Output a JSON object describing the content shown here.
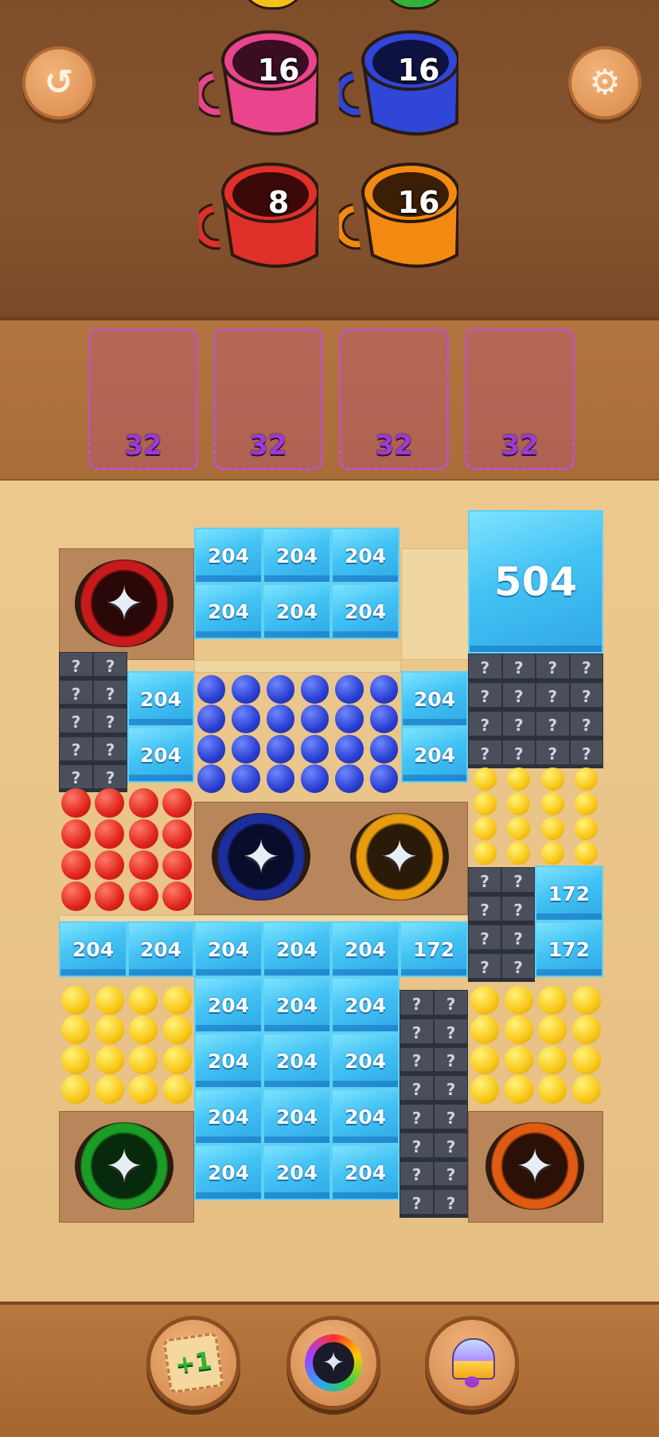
{
  "header": {
    "restart_button": {
      "icon": "restart-icon"
    },
    "settings_button": {
      "icon": "gear-icon"
    }
  },
  "cups": [
    {
      "color": "#e8458c",
      "count": "16"
    },
    {
      "color": "#2f46d6",
      "count": "16"
    },
    {
      "color": "#e0302a",
      "count": "8"
    },
    {
      "color": "#f28a12",
      "count": "16"
    }
  ],
  "slots": [
    {
      "count": "32"
    },
    {
      "count": "32"
    },
    {
      "count": "32"
    },
    {
      "count": "32"
    }
  ],
  "board": {
    "big_ice": "504",
    "ice": {
      "top_row1": [
        "204",
        "204",
        "204"
      ],
      "top_row2": [
        "204",
        "204",
        "204"
      ],
      "left": [
        "204",
        "204"
      ],
      "right": [
        "204",
        "204"
      ],
      "mid_row": [
        "204",
        "204",
        "204",
        "204",
        "204",
        "172"
      ],
      "right_stack": [
        "172",
        "172"
      ],
      "center_grid": [
        [
          "204",
          "204",
          "204"
        ],
        [
          "204",
          "204",
          "204"
        ],
        [
          "204",
          "204",
          "204"
        ],
        [
          "204",
          "204",
          "204"
        ]
      ]
    },
    "mystery_symbol": "?",
    "spinners": [
      {
        "name": "red",
        "color": "#c81a1a"
      },
      {
        "name": "blue",
        "color": "#1c2d9c"
      },
      {
        "name": "orange-yellow",
        "color": "#e89b0c"
      },
      {
        "name": "green",
        "color": "#1a9c26"
      },
      {
        "name": "orange",
        "color": "#e05a12"
      }
    ]
  },
  "tools": [
    {
      "name": "add-slot",
      "label": "+1",
      "icon": "add-slot-icon"
    },
    {
      "name": "shuffle",
      "icon": "shuriken-rainbow-icon"
    },
    {
      "name": "bell",
      "icon": "bell-icon"
    }
  ]
}
